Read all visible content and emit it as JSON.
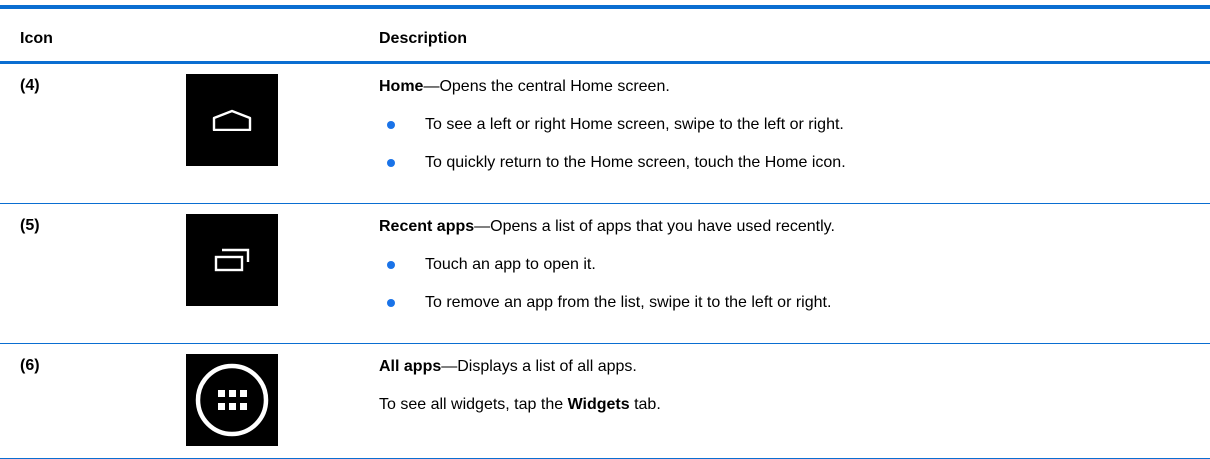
{
  "header": {
    "icon_col": "Icon",
    "desc_col": "Description"
  },
  "rows": [
    {
      "num": "(4)",
      "icon": "home-icon",
      "title": "Home",
      "title_rest": "—Opens the central Home screen.",
      "bullets": [
        "To see a left or right Home screen, swipe to the left or right.",
        "To quickly return to the Home screen, touch the Home icon."
      ]
    },
    {
      "num": "(5)",
      "icon": "recent-apps-icon",
      "title": "Recent apps",
      "title_rest": "—Opens a list of apps that you have used recently.",
      "bullets": [
        "Touch an app to open it.",
        "To remove an app from the list, swipe it to the left or right."
      ]
    },
    {
      "num": "(6)",
      "icon": "all-apps-icon",
      "title": "All apps",
      "title_rest": "—Displays a list of all apps.",
      "extra_pre": "To see all widgets, tap the ",
      "extra_bold": "Widgets",
      "extra_post": " tab."
    }
  ],
  "colors": {
    "rule": "#0a6ed1",
    "bullet": "#1a73e8",
    "icon_bg": "#000000"
  }
}
